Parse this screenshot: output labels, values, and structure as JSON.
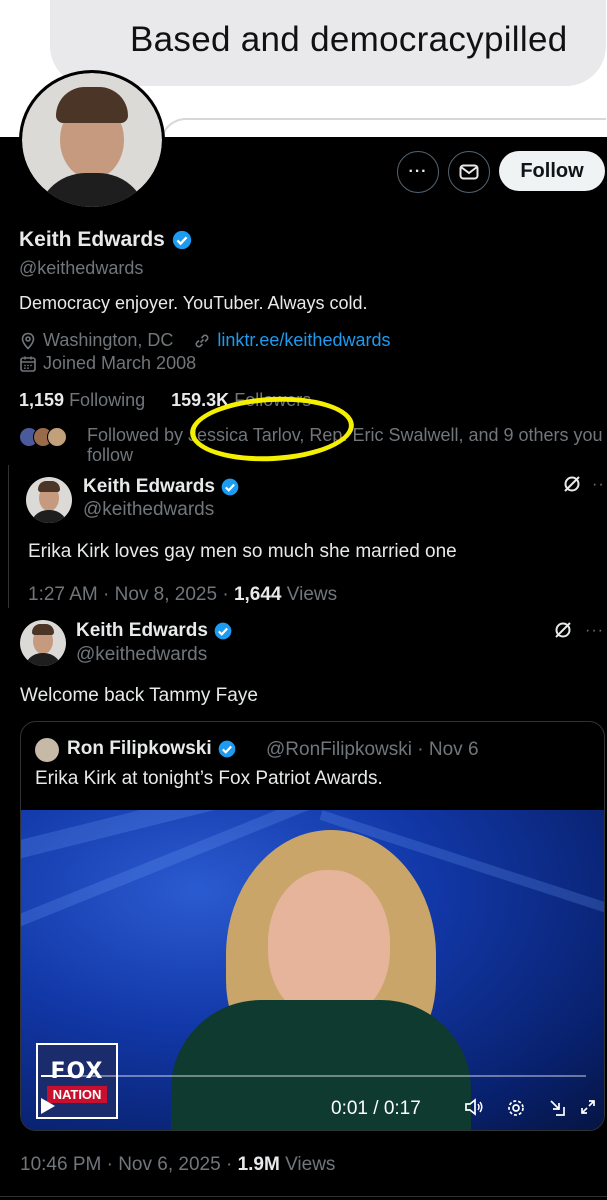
{
  "message": {
    "text": "Based and democracypilled"
  },
  "profile": {
    "name": "Keith Edwards",
    "handle": "@keithedwards",
    "bio": "Democracy enjoyer. YouTuber. Always cold.",
    "location": "Washington, DC",
    "link": "linktr.ee/keithedwards",
    "joined": "Joined March 2008",
    "following_count": "1,159",
    "following_label": "Following",
    "followers_count": "159.3K",
    "followers_label": "Followers",
    "followed_by": "Followed by Jessica Tarlov, Rep. Eric Swalwell, and 9 others you follow",
    "follow_button": "Follow",
    "more_icon": "more-icon",
    "message_icon": "envelope-icon"
  },
  "tweet1": {
    "name": "Keith Edwards",
    "handle": "@keithedwards",
    "text": "Erika Kirk loves gay men so much she married one",
    "time": "1:27 AM · Nov 8, 2025 · ",
    "views_count": "1,644",
    "views_label": " Views"
  },
  "tweet2": {
    "name": "Keith Edwards",
    "handle": "@keithedwards",
    "text": "Welcome back Tammy Faye",
    "time": "10:46 PM · Nov 6, 2025 · ",
    "views_count": "1.9M",
    "views_label": " Views",
    "quote": {
      "name": "Ron Filipkowski",
      "handle": "@RonFilipkowski · Nov 6",
      "text": "Erika Kirk at tonight’s Fox Patriot Awards."
    },
    "video": {
      "logo_top": "FOX",
      "logo_bottom": "NATION",
      "time": "0:01 / 0:17",
      "progress": 0.06
    }
  },
  "colors": {
    "accent": "#1d9bf0",
    "annotation": "#f5f000",
    "background": "#000000"
  }
}
